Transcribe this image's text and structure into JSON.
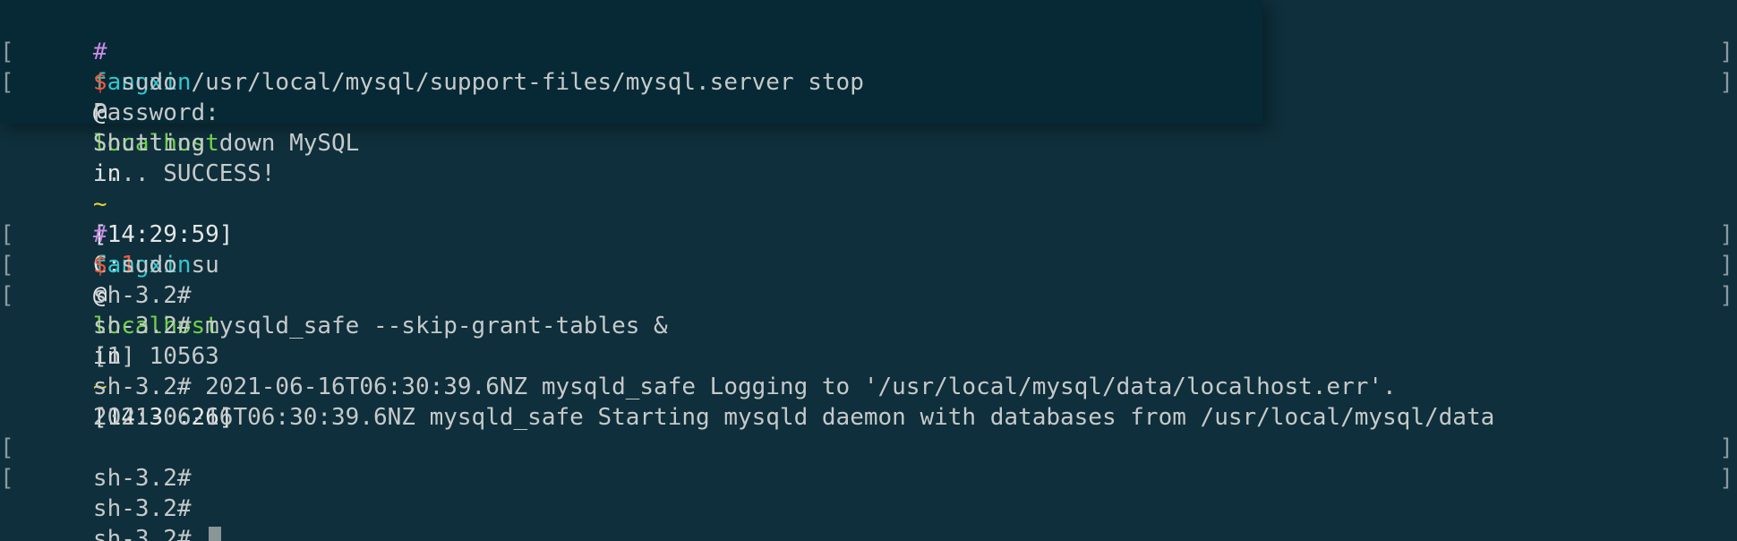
{
  "colors": {
    "background": "#0e2f3b",
    "highlight_block": "#062935",
    "text": "#c6c9ca",
    "hash": "#c98be8",
    "user": "#33c6cf",
    "host": "#72d04a",
    "tilde": "#e6d334",
    "error_code": "#ee5a3c",
    "dollar": "#ee5a3c",
    "cursor": "#8a9597"
  },
  "prompt1": {
    "hash": "#",
    "user": "fangxin",
    "at": "@",
    "host": "localhost",
    "in": "in",
    "path": "~",
    "time": "[14:29:59]",
    "code_label": "C:",
    "code_value": "1"
  },
  "prompt2": {
    "hash": "#",
    "user": "fangxin",
    "at": "@",
    "host": "localhost",
    "in": "in",
    "path": "~",
    "time": "[14:30:26]"
  },
  "dollar": "$",
  "line_bracket_left": "[",
  "line_bracket_right": "]",
  "lines": {
    "cmd_stop": " sudo /usr/local/mysql/support-files/mysql.server stop",
    "password": "Password:",
    "shutting_down": "Shutting down MySQL",
    "success": ".... SUCCESS!",
    "cmd_sudo_su": " sudo su",
    "sh_prompt_1": "sh-3.2#",
    "sh_mysqld_safe": "sh-3.2# mysqld_safe --skip-grant-tables &",
    "job": "[1] 10563",
    "logging": "sh-3.2# 2021-06-16T06:30:39.6NZ mysqld_safe Logging to '/usr/local/mysql/data/localhost.err'.",
    "starting": "2021-06-16T06:30:39.6NZ mysqld_safe Starting mysqld daemon with databases from /usr/local/mysql/data",
    "sh_prompt_2": "sh-3.2#",
    "sh_prompt_3": "sh-3.2#",
    "sh_prompt_final": "sh-3.2# "
  }
}
